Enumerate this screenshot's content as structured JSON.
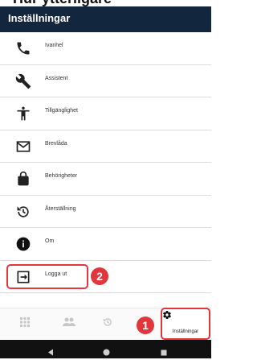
{
  "page_heading": "Hur ytterligare",
  "header": {
    "title": "Inställningar"
  },
  "menu": {
    "items": [
      {
        "label": "Ivanhel",
        "icon": "phone-icon"
      },
      {
        "label": "Assistent",
        "icon": "wrench-icon"
      },
      {
        "label": "Tillgänglighet",
        "icon": "accessibility-icon"
      },
      {
        "label": "Brevlåda",
        "icon": "mail-icon"
      },
      {
        "label": "Behörigheter",
        "icon": "lock-icon"
      },
      {
        "label": "Återställning",
        "icon": "restore-icon"
      },
      {
        "label": "Om",
        "icon": "info-icon"
      },
      {
        "label": "Logga ut",
        "icon": "logout-icon",
        "highlighted": true
      }
    ]
  },
  "badges": {
    "logout_step": "2",
    "settings_step": "1"
  },
  "bottom_nav": {
    "items": [
      {
        "icon": "grid-icon"
      },
      {
        "icon": "people-icon"
      },
      {
        "icon": "history-icon"
      },
      {
        "icon": "gear-icon",
        "label": "Inställningar",
        "active": true
      }
    ]
  },
  "colors": {
    "header": "#12263e",
    "highlight": "#e1363b",
    "android_nav": "#111111"
  }
}
